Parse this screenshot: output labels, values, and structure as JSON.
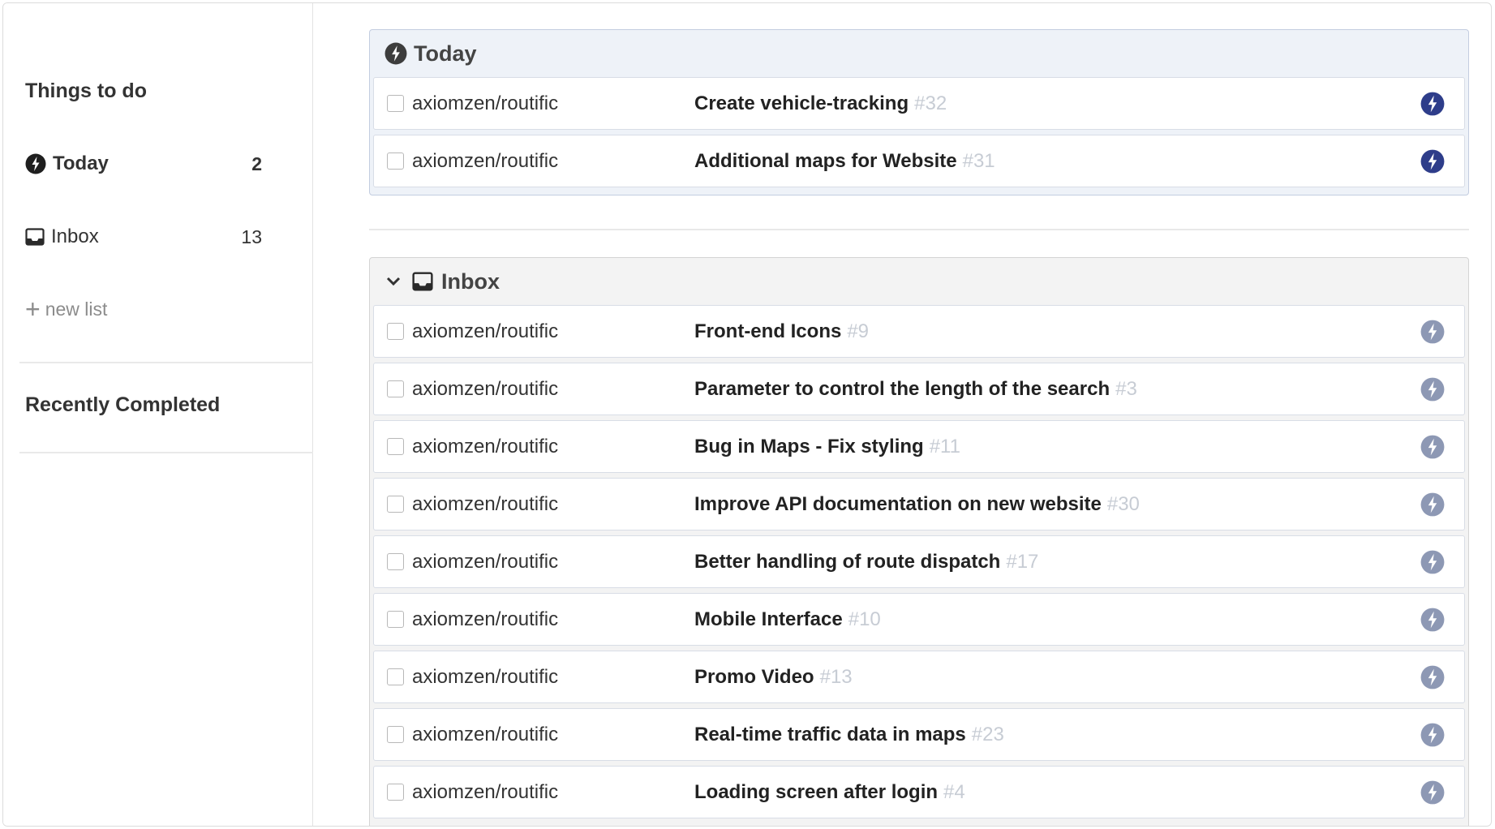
{
  "sidebar": {
    "heading": "Things to do",
    "items": [
      {
        "label": "Today",
        "count": "2",
        "icon": "bolt-circle-icon"
      },
      {
        "label": "Inbox",
        "count": "13",
        "icon": "inbox-tray-icon"
      }
    ],
    "new_list_label": "new list",
    "recent_heading": "Recently Completed"
  },
  "today_panel": {
    "title": "Today",
    "tasks": [
      {
        "repo": "axiomzen/routific",
        "title": "Create vehicle-tracking",
        "number": "#32"
      },
      {
        "repo": "axiomzen/routific",
        "title": "Additional maps for Website",
        "number": "#31"
      }
    ]
  },
  "inbox_panel": {
    "title": "Inbox",
    "tasks": [
      {
        "repo": "axiomzen/routific",
        "title": "Front-end Icons",
        "number": "#9"
      },
      {
        "repo": "axiomzen/routific",
        "title": "Parameter to control the length of the search",
        "number": "#3"
      },
      {
        "repo": "axiomzen/routific",
        "title": "Bug in Maps - Fix styling",
        "number": "#11"
      },
      {
        "repo": "axiomzen/routific",
        "title": "Improve API documentation on new website",
        "number": "#30"
      },
      {
        "repo": "axiomzen/routific",
        "title": "Better handling of route dispatch",
        "number": "#17"
      },
      {
        "repo": "axiomzen/routific",
        "title": "Mobile Interface",
        "number": "#10"
      },
      {
        "repo": "axiomzen/routific",
        "title": "Promo Video",
        "number": "#13"
      },
      {
        "repo": "axiomzen/routific",
        "title": "Real-time traffic data in maps",
        "number": "#23"
      },
      {
        "repo": "axiomzen/routific",
        "title": "Loading screen after login",
        "number": "#4"
      }
    ]
  },
  "colors": {
    "today_bolt": "#2e3d8a",
    "inbox_bolt": "#8d98b4",
    "sidebar_bolt": "#1f1f1f"
  }
}
